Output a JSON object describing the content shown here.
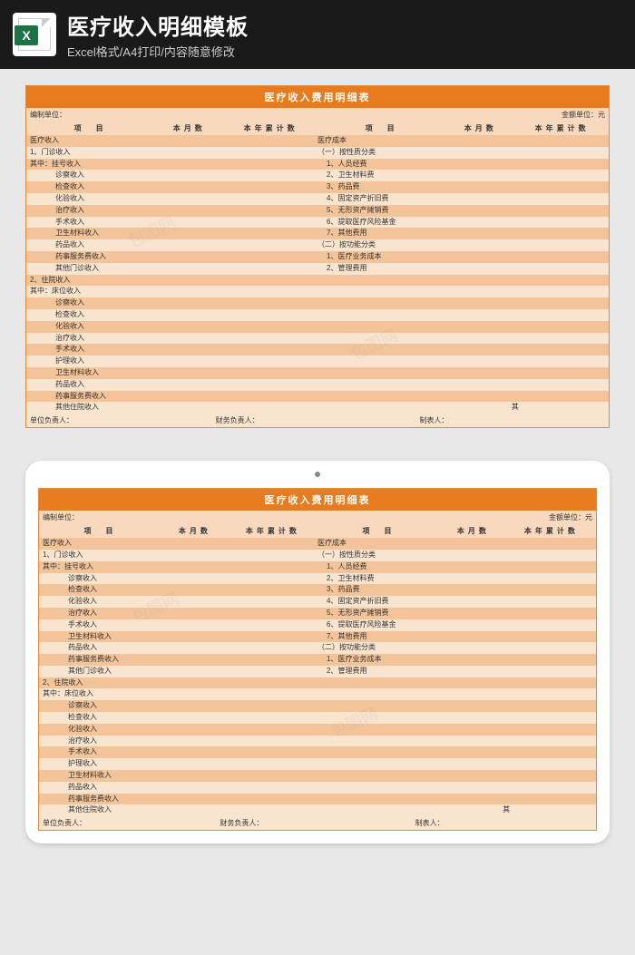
{
  "header": {
    "title": "医疗收入明细模板",
    "subtitle": "Excel格式/A4打印/内容随意修改",
    "icon_letter": "X"
  },
  "sheet": {
    "title": "医疗收入费用明细表",
    "meta_left": "编制单位：",
    "meta_right": "金额单位：元",
    "col_item": "项　目",
    "col_month": "本月数",
    "col_year": "本年累计数",
    "footer_unit": "单位负责人：",
    "footer_finance": "财务负责人：",
    "footer_maker": "制表人：",
    "qi": "其"
  },
  "rows": [
    {
      "l": "医疗收入",
      "li": 1,
      "r": "医疗成本",
      "ri": 1
    },
    {
      "l": "1、门诊收入",
      "li": 1,
      "r": "（一）按性质分类",
      "ri": 1
    },
    {
      "l": "其中：挂号收入",
      "li": 1,
      "r": "1、人员经费",
      "ri": 2
    },
    {
      "l": "诊察收入",
      "li": 3,
      "r": "2、卫生材料费",
      "ri": 2
    },
    {
      "l": "检查收入",
      "li": 3,
      "r": "3、药品费",
      "ri": 2
    },
    {
      "l": "化验收入",
      "li": 3,
      "r": "4、固定资产折旧费",
      "ri": 2
    },
    {
      "l": "治疗收入",
      "li": 3,
      "r": "5、无形资产摊销费",
      "ri": 2
    },
    {
      "l": "手术收入",
      "li": 3,
      "r": "6、提取医疗风险基金",
      "ri": 2
    },
    {
      "l": "卫生材料收入",
      "li": 3,
      "r": "7、其他费用",
      "ri": 2
    },
    {
      "l": "药品收入",
      "li": 3,
      "r": "（二）按功能分类",
      "ri": 1
    },
    {
      "l": "药事服务费收入",
      "li": 3,
      "r": "1、医疗业务成本",
      "ri": 2
    },
    {
      "l": "其他门诊收入",
      "li": 3,
      "r": "2、管理费用",
      "ri": 2
    },
    {
      "l": "2、住院收入",
      "li": 1,
      "r": "",
      "ri": 1
    },
    {
      "l": "其中：床位收入",
      "li": 1,
      "r": "",
      "ri": 1
    },
    {
      "l": "诊察收入",
      "li": 3,
      "r": "",
      "ri": 1
    },
    {
      "l": "检查收入",
      "li": 3,
      "r": "",
      "ri": 1
    },
    {
      "l": "化验收入",
      "li": 3,
      "r": "",
      "ri": 1
    },
    {
      "l": "治疗收入",
      "li": 3,
      "r": "",
      "ri": 1
    },
    {
      "l": "手术收入",
      "li": 3,
      "r": "",
      "ri": 1
    },
    {
      "l": "护理收入",
      "li": 3,
      "r": "",
      "ri": 1
    },
    {
      "l": "卫生材料收入",
      "li": 3,
      "r": "",
      "ri": 1
    },
    {
      "l": "药品收入",
      "li": 3,
      "r": "",
      "ri": 1
    },
    {
      "l": "药事服务费收入",
      "li": 3,
      "r": "",
      "ri": 1
    },
    {
      "l": "其他住院收入",
      "li": 3,
      "r": "",
      "ri": 1
    }
  ],
  "watermark": "包图网"
}
